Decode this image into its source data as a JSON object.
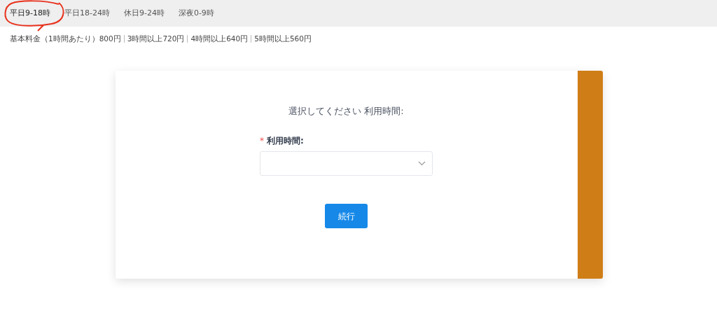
{
  "tabs": [
    {
      "label": "平日9-18時",
      "selected": true
    },
    {
      "label": "平日18-24時",
      "selected": false
    },
    {
      "label": "休日9-24時",
      "selected": false
    },
    {
      "label": "深夜0-9時",
      "selected": false
    }
  ],
  "annotation": {
    "kind": "circle"
  },
  "prices": [
    "基本料金（1時間あたり）800円",
    "3時間以上720円",
    "4時間以上640円",
    "5時間以上560円"
  ],
  "form": {
    "heading": "選択してください 利用時間:",
    "field": {
      "label": "利用時間:",
      "required": true,
      "required_mark": "*"
    },
    "button": "続行"
  }
}
